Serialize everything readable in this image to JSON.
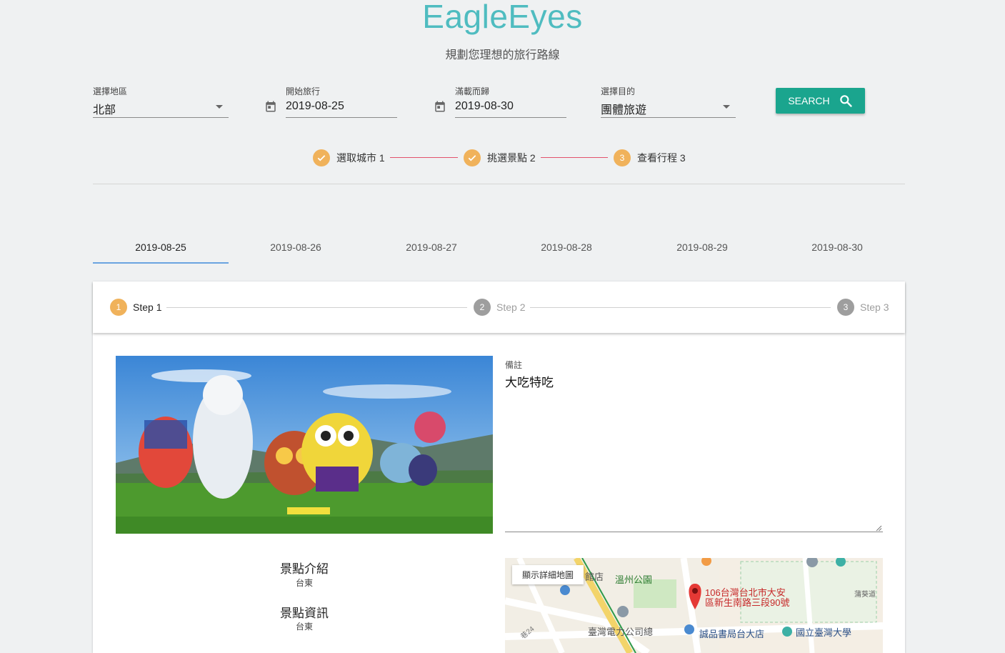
{
  "app": {
    "title": "EagleEyes",
    "subtitle": "規劃您理想的旅行路線"
  },
  "search": {
    "region": {
      "label": "選擇地區",
      "value": "北部"
    },
    "start": {
      "label": "開始旅行",
      "value": "2019-08-25"
    },
    "end": {
      "label": "滿載而歸",
      "value": "2019-08-30"
    },
    "purpose": {
      "label": "選擇目的",
      "value": "團體旅遊"
    },
    "button_label": "SEARCH"
  },
  "progress": {
    "steps": [
      {
        "label": "選取城市 1",
        "state": "done"
      },
      {
        "label": "挑選景點 2",
        "state": "done"
      },
      {
        "label": "查看行程 3",
        "state": "active",
        "number": "3"
      }
    ]
  },
  "date_tabs": [
    "2019-08-25",
    "2019-08-26",
    "2019-08-27",
    "2019-08-28",
    "2019-08-29",
    "2019-08-30"
  ],
  "itinerary": {
    "steps": [
      {
        "number": "1",
        "label": "Step 1"
      },
      {
        "number": "2",
        "label": "Step 2"
      },
      {
        "number": "3",
        "label": "Step 3"
      }
    ],
    "note": {
      "label": "備註",
      "value": "大吃特吃"
    },
    "intro": {
      "heading": "景點介紹",
      "value": "台東"
    },
    "details": {
      "heading": "景點資訊",
      "value": "台東"
    },
    "map": {
      "button_label": "顯示詳細地圖",
      "address_line1": "106台灣台北市大安",
      "address_line2": "區新生南路三段90號",
      "labels": [
        "館店",
        "溫州公園",
        "臺灣電力公司總",
        "誠品書局台大店",
        "國立臺灣大學",
        "蒲葵道",
        "巷24"
      ]
    }
  },
  "colors": {
    "accent": "#4fbcc0",
    "button": "#1aa58e",
    "step": "#f0b25b",
    "connector": "#e2526c",
    "tab_indicator": "#6aa3e0"
  }
}
